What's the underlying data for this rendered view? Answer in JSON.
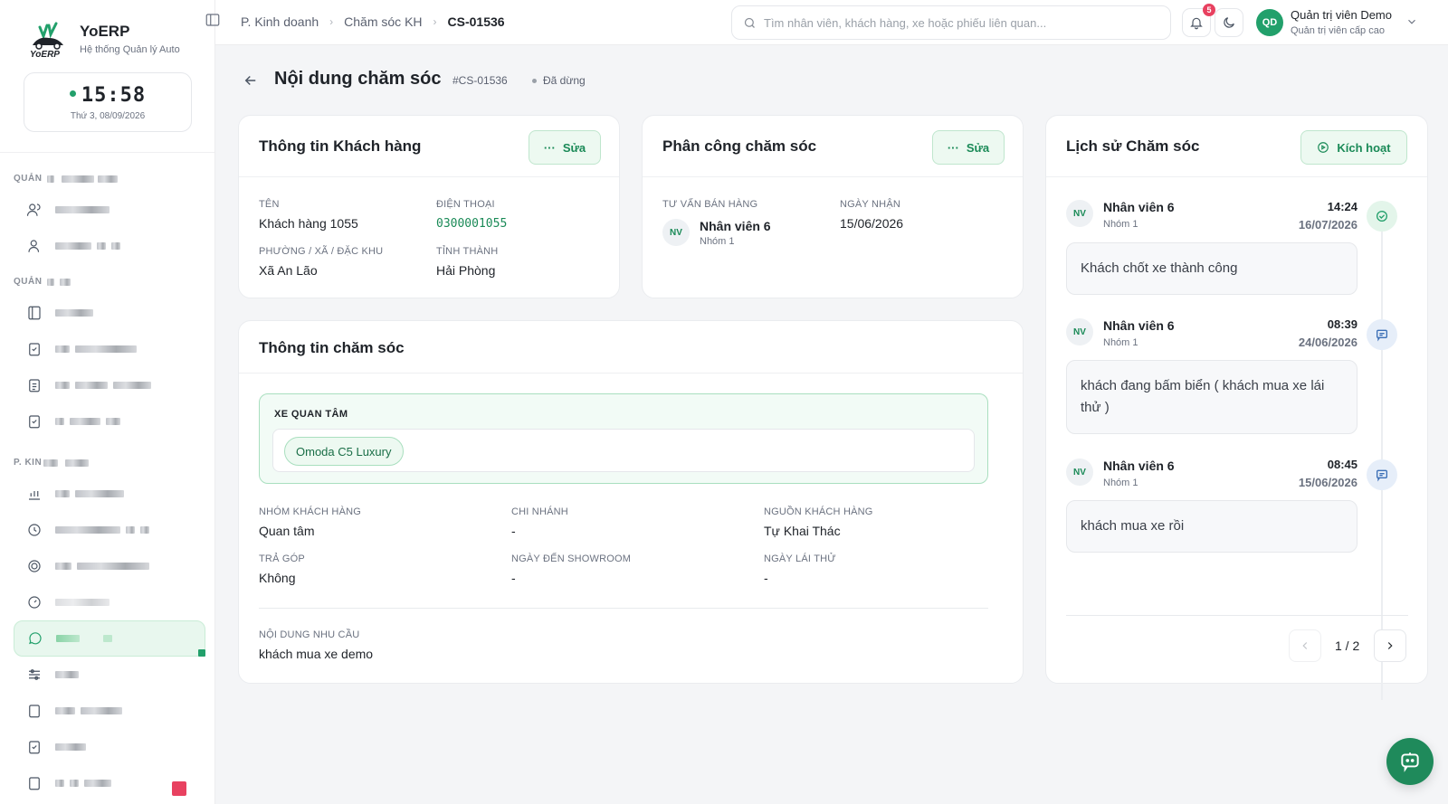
{
  "brand": {
    "name": "YoERP",
    "subtitle": "Hệ thống Quản lý Auto",
    "logo_text": "YoERP"
  },
  "clock": {
    "time": "15:58",
    "date": "Thứ 3, 08/09/2026"
  },
  "sidebar": {
    "sections": [
      {
        "label": "QUẢN"
      },
      {
        "label": "QUẢN"
      },
      {
        "label": "P. KIN"
      }
    ]
  },
  "breadcrumb": {
    "items": [
      "P. Kinh doanh",
      "Chăm sóc KH"
    ],
    "current": "CS-01536"
  },
  "search": {
    "placeholder": "Tìm nhân viên, khách hàng, xe hoặc phiếu liên quan..."
  },
  "notifications": {
    "count": "5"
  },
  "user": {
    "initials": "QD",
    "name": "Quản trị viên Demo",
    "role": "Quản trị viên cấp cao"
  },
  "page": {
    "title": "Nội dung chăm sóc",
    "code": "#CS-01536",
    "status": "Đã dừng"
  },
  "customer": {
    "title": "Thông tin Khách hàng",
    "edit_label": "Sửa",
    "name_label": "TÊN",
    "name": "Khách hàng 1055",
    "phone_label": "ĐIỆN THOẠI",
    "phone": "0300001055",
    "ward_label": "PHƯỜNG / XÃ / ĐẶC KHU",
    "ward": "Xã An Lão",
    "province_label": "TỈNH THÀNH",
    "province": "Hải Phòng"
  },
  "assignment": {
    "title": "Phân công chăm sóc",
    "edit_label": "Sửa",
    "advisor_label": "TƯ VẤN BÁN HÀNG",
    "advisor_initials": "NV",
    "advisor_name": "Nhân viên 6",
    "advisor_group": "Nhóm 1",
    "received_label": "NGÀY NHẬN",
    "received": "15/06/2026"
  },
  "care": {
    "title": "Thông tin chăm sóc",
    "interest_label": "XE QUAN TÂM",
    "interest_chip": "Omoda C5 Luxury",
    "group_label": "NHÓM KHÁCH HÀNG",
    "group": "Quan tâm",
    "branch_label": "CHI NHÁNH",
    "branch": "-",
    "source_label": "NGUỒN KHÁCH HÀNG",
    "source": "Tự Khai Thác",
    "installment_label": "TRẢ GÓP",
    "installment": "Không",
    "showroom_label": "NGÀY ĐẾN SHOWROOM",
    "showroom": "-",
    "testdrive_label": "NGÀY LÁI THỬ",
    "testdrive": "-",
    "need_label": "NỘI DUNG NHU CẦU",
    "need": "khách mua xe demo"
  },
  "history": {
    "title": "Lịch sử Chăm sóc",
    "activate_label": "Kích hoạt",
    "entries": [
      {
        "initials": "NV",
        "name": "Nhân viên 6",
        "group": "Nhóm 1",
        "time": "14:24",
        "date": "16/07/2026",
        "note": "Khách chốt xe thành công",
        "icon": "check-circle-icon"
      },
      {
        "initials": "NV",
        "name": "Nhân viên 6",
        "group": "Nhóm 1",
        "time": "08:39",
        "date": "24/06/2026",
        "note": "khách đang bấm biển ( khách mua xe lái thử )",
        "icon": "message-icon"
      },
      {
        "initials": "NV",
        "name": "Nhân viên 6",
        "group": "Nhóm 1",
        "time": "08:45",
        "date": "15/06/2026",
        "note": "khách mua xe rồi",
        "icon": "message-icon"
      }
    ],
    "pager": "1 / 2"
  },
  "colors": {
    "accent": "#22a06b",
    "accent_dark": "#1a8a57",
    "badge": "#e84160"
  }
}
